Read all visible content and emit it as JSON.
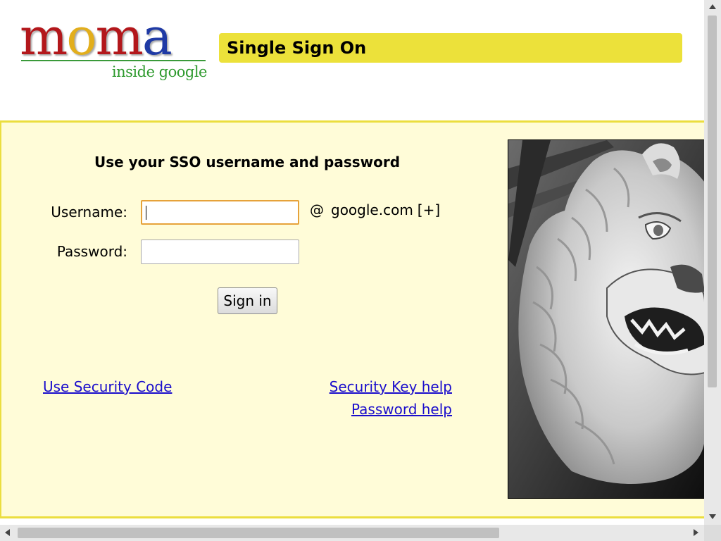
{
  "logo": {
    "letters": [
      "m",
      "o",
      "m",
      "a"
    ],
    "letter_colors": [
      "#b3171b",
      "#e2ae1c",
      "#b3171b",
      "#1f3aa5"
    ],
    "tagline": "inside google"
  },
  "header": {
    "title": "Single Sign On"
  },
  "form": {
    "heading": "Use your SSO username and password",
    "username_label": "Username:",
    "username_value": "",
    "at_sign": "@",
    "domain": "google.com",
    "domain_toggle": "[+]",
    "password_label": "Password:",
    "password_value": "",
    "submit_label": "Sign in"
  },
  "links": {
    "security_code": "Use Security Code",
    "security_key_help": "Security Key help",
    "password_help": "Password help"
  },
  "photo": {
    "subject": "lion-statue"
  },
  "colors": {
    "title_bar": "#ece13a",
    "panel_bg": "#fffcd8",
    "panel_border": "#ebde3f",
    "link": "#1a0dcc",
    "focus_ring": "#e6a23a"
  }
}
